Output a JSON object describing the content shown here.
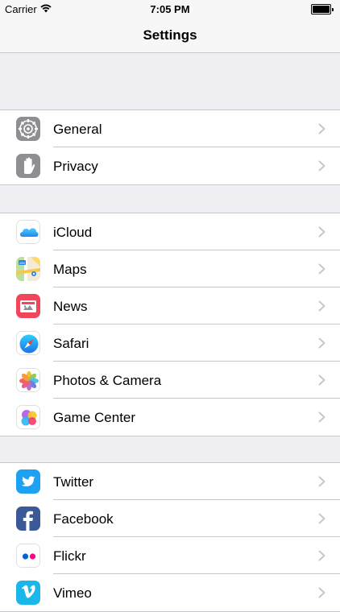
{
  "status_bar": {
    "carrier": "Carrier",
    "time": "7:05 PM",
    "battery_level": 1.0
  },
  "nav": {
    "title": "Settings"
  },
  "groups": [
    {
      "items": [
        {
          "label": "General",
          "icon": "gear-icon"
        },
        {
          "label": "Privacy",
          "icon": "hand-icon"
        }
      ]
    },
    {
      "items": [
        {
          "label": "iCloud",
          "icon": "cloud-icon"
        },
        {
          "label": "Maps",
          "icon": "map-icon"
        },
        {
          "label": "News",
          "icon": "news-icon"
        },
        {
          "label": "Safari",
          "icon": "compass-icon"
        },
        {
          "label": "Photos & Camera",
          "icon": "photos-icon"
        },
        {
          "label": "Game Center",
          "icon": "game-center-icon"
        }
      ]
    },
    {
      "items": [
        {
          "label": "Twitter",
          "icon": "twitter-bird-icon"
        },
        {
          "label": "Facebook",
          "icon": "facebook-icon"
        },
        {
          "label": "Flickr",
          "icon": "flickr-icon"
        },
        {
          "label": "Vimeo",
          "icon": "vimeo-icon"
        }
      ]
    }
  ],
  "colors": {
    "background": "#efeff4",
    "separator": "#c8c7cc",
    "chevron": "#c7c7cc",
    "settings_gray": "#8e8e93",
    "news_red": "#f0455b",
    "twitter_blue": "#1da1f2",
    "facebook_blue": "#3b5998",
    "vimeo_blue": "#1ab7ea",
    "flickr_blue": "#0063dc",
    "flickr_pink": "#ff0084"
  }
}
